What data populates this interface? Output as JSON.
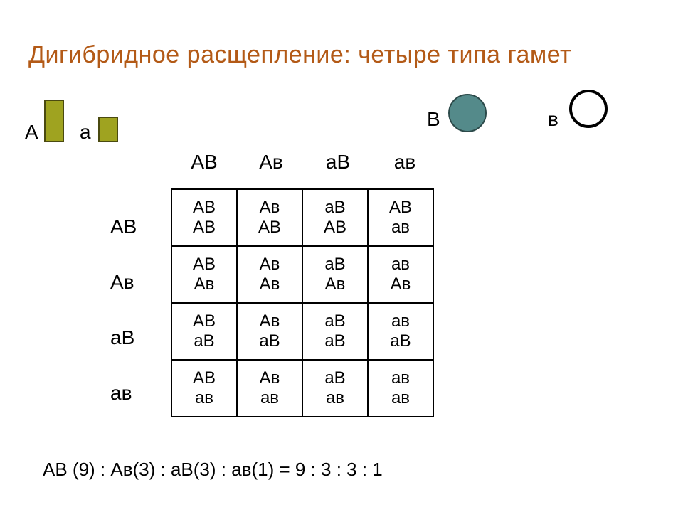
{
  "title": "Дигибридное расщепление: четыре типа гамет",
  "alleles": {
    "A_big_label": "А",
    "A_small_label": "а",
    "B_big_label": "В",
    "B_small_label": "в"
  },
  "col_headers": [
    "АВ",
    "Ав",
    "аВ",
    "ав"
  ],
  "row_headers": [
    "АВ",
    "Ав",
    "аВ",
    "ав"
  ],
  "cells": [
    [
      [
        "АВ",
        "АВ"
      ],
      [
        "Ав",
        "АВ"
      ],
      [
        "аВ",
        "АВ"
      ],
      [
        "АВ",
        "ав"
      ]
    ],
    [
      [
        "АВ",
        "Ав"
      ],
      [
        "Ав",
        "Ав"
      ],
      [
        "аВ",
        "Ав"
      ],
      [
        "ав",
        "Ав"
      ]
    ],
    [
      [
        "АВ",
        "аВ"
      ],
      [
        "Ав",
        "аВ"
      ],
      [
        "аВ",
        "аВ"
      ],
      [
        "ав",
        "аВ"
      ]
    ],
    [
      [
        "АВ",
        "ав"
      ],
      [
        "Ав",
        "ав"
      ],
      [
        "аВ",
        "ав"
      ],
      [
        "ав",
        "ав"
      ]
    ]
  ],
  "ratio_line": "АВ (9) : Ав(3) : аВ(3) : ав(1) = 9 : 3 : 3 : 1",
  "chart_data": {
    "type": "table",
    "title": "Дигибридное расщепление: четыре типа гамет",
    "row_gametes": [
      "АВ",
      "Ав",
      "аВ",
      "ав"
    ],
    "col_gametes": [
      "АВ",
      "Ав",
      "аВ",
      "ав"
    ],
    "genotype_grid": [
      [
        "АВ/АВ",
        "Ав/АВ",
        "аВ/АВ",
        "АВ/ав"
      ],
      [
        "АВ/Ав",
        "Ав/Ав",
        "аВ/Ав",
        "ав/Ав"
      ],
      [
        "АВ/аВ",
        "Ав/аВ",
        "аВ/аВ",
        "ав/аВ"
      ],
      [
        "АВ/ав",
        "Ав/ав",
        "аВ/ав",
        "ав/ав"
      ]
    ],
    "phenotype_ratio": {
      "АВ": 9,
      "Ав": 3,
      "аВ": 3,
      "ав": 1
    },
    "ratio_string": "9 : 3 : 3 : 1",
    "allele_legend": {
      "А": "tall bar (dominant)",
      "а": "short bar (recessive)",
      "В": "filled circle (dominant)",
      "в": "open circle (recessive)"
    }
  }
}
